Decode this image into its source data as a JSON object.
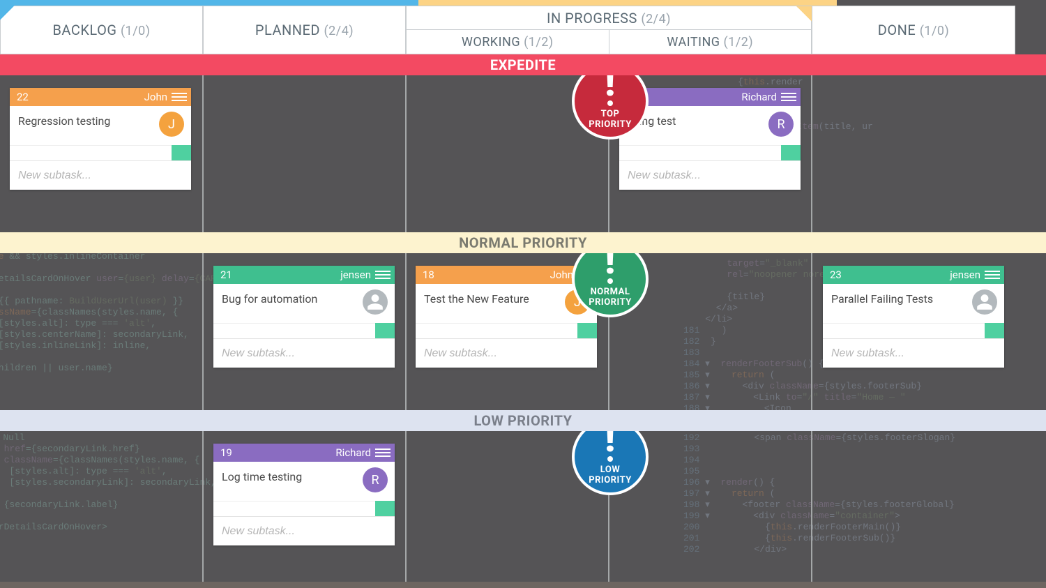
{
  "columns": {
    "backlog": {
      "label": "BACKLOG",
      "count": "(1/0)"
    },
    "planned": {
      "label": "PLANNED",
      "count": "(2/4)"
    },
    "inprogress": {
      "label": "IN PROGRESS",
      "count": "(2/4)"
    },
    "working": {
      "label": "WORKING",
      "count": "(1/2)"
    },
    "waiting": {
      "label": "WAITING",
      "count": "(1/2)"
    },
    "done": {
      "label": "DONE",
      "count": "(1/0)"
    }
  },
  "swimlanes": {
    "expedite": {
      "label": "EXPEDITE"
    },
    "normal": {
      "label": "NORMAL PRIORITY"
    },
    "low": {
      "label": "LOW PRIORITY"
    }
  },
  "badges": {
    "top": {
      "line1": "TOP",
      "line2": "PRIORITY"
    },
    "normal": {
      "line1": "NORMAL",
      "line2": "PRIORITY"
    },
    "low": {
      "line1": "LOW",
      "line2": "PRIORITY"
    }
  },
  "subtask_placeholder": "New subtask...",
  "cards": {
    "c22": {
      "id": "22",
      "user": "John",
      "title": "Regression testing",
      "avatar_letter": "J"
    },
    "cFail": {
      "id": "",
      "user": "Richard",
      "title": "ailing test",
      "avatar_letter": "R"
    },
    "c21": {
      "id": "21",
      "user": "jensen",
      "title": "Bug for automation",
      "avatar_letter": ""
    },
    "c18": {
      "id": "18",
      "user": "John",
      "title": "Test the New Feature",
      "avatar_letter": "J"
    },
    "c23": {
      "id": "23",
      "user": "jensen",
      "title": "Parallel Failing Tests",
      "avatar_letter": ""
    },
    "c19": {
      "id": "19",
      "user": "Richard",
      "title": "Log time testing",
      "avatar_letter": "R"
    }
  }
}
